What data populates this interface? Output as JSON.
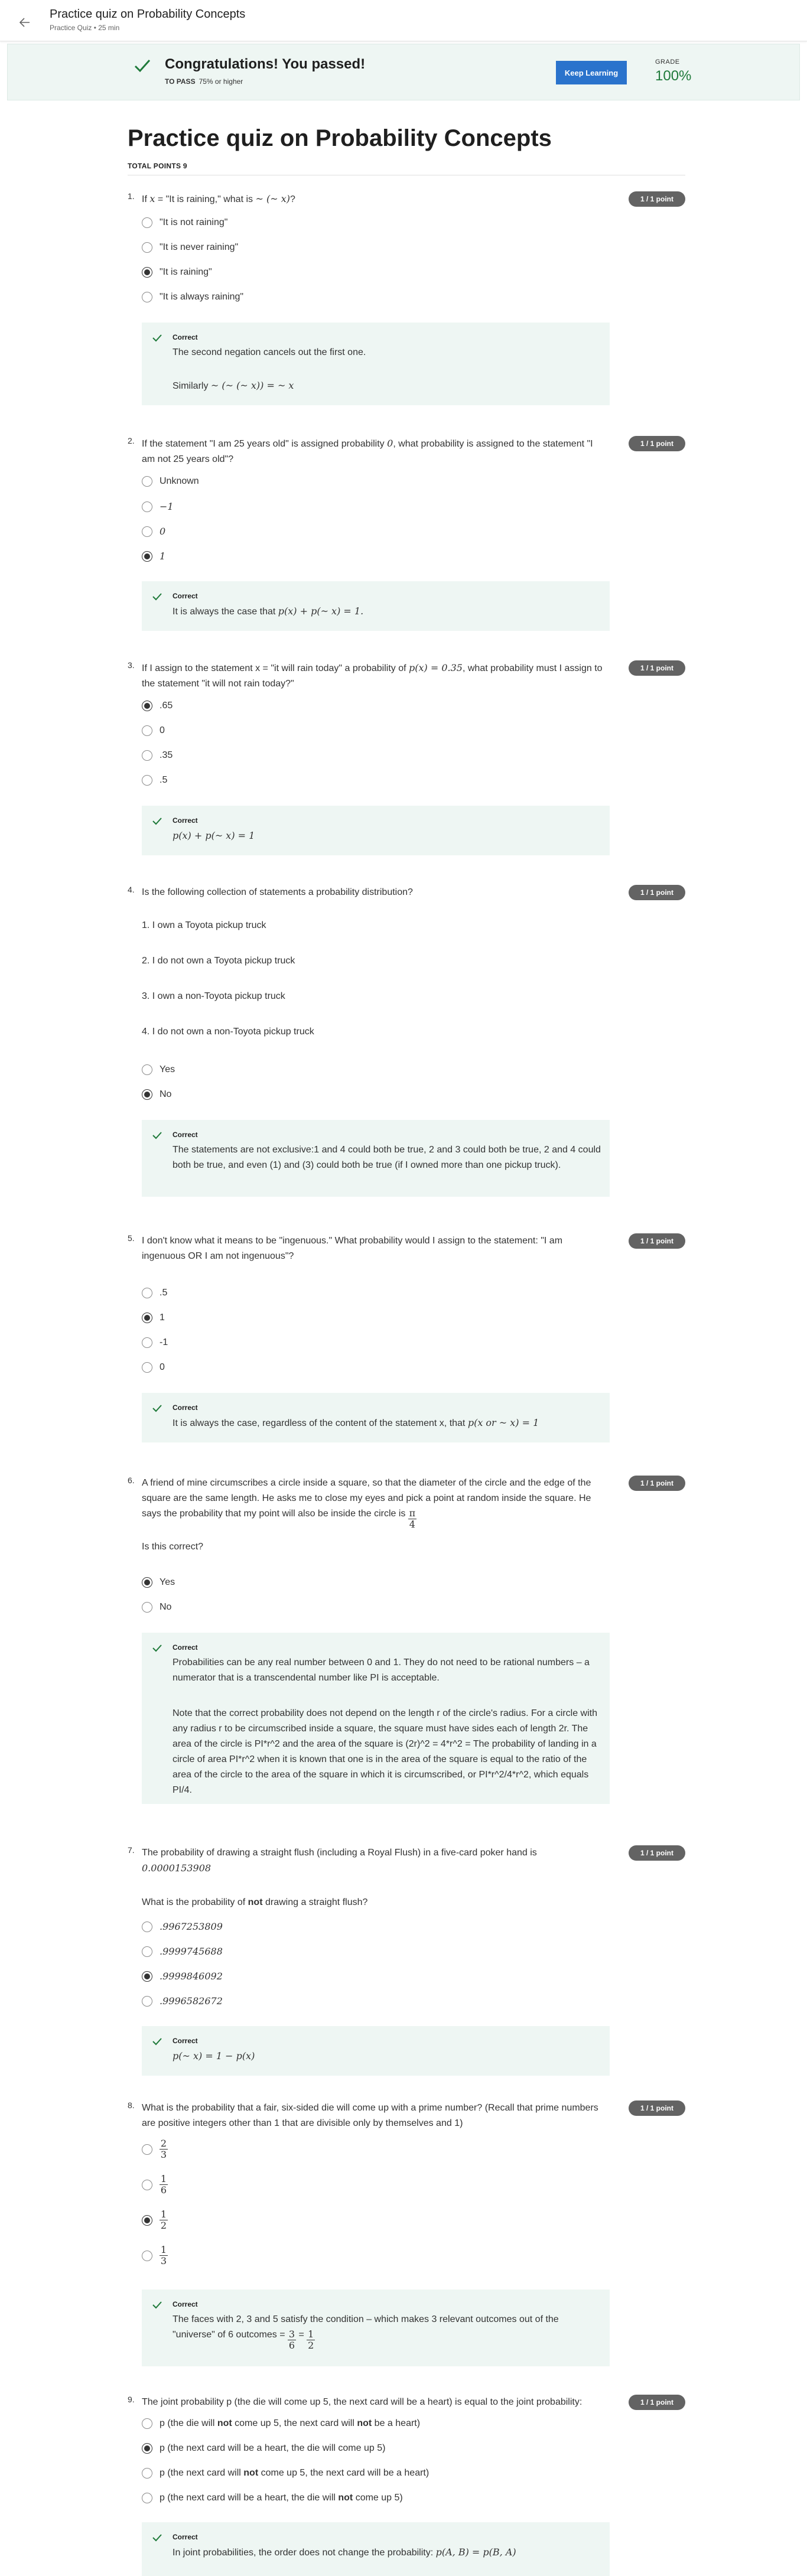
{
  "topbar": {
    "title": "Practice quiz on Probability Concepts",
    "subtitle": "Practice Quiz • 25 min"
  },
  "banner": {
    "title": "Congratulations! You passed!",
    "to_pass_label": "TO PASS",
    "to_pass_value": "75% or higher",
    "button": "Keep Learning",
    "grade_label": "GRADE",
    "grade_value": "100%"
  },
  "page": {
    "title": "Practice quiz on Probability Concepts",
    "total_points": "TOTAL POINTS 9"
  },
  "badge": "1 / 1 point",
  "correct": "Correct",
  "q1": {
    "num": "1.",
    "text_a": "If ",
    "text_math": "x",
    "text_b": " = \"It is raining,\" what is ",
    "text_math2": "~ (~ x)",
    "text_c": "?",
    "options": [
      "\"It is not raining\"",
      "\"It is never raining\"",
      "\"It is raining\"",
      "\"It is always raining\""
    ],
    "fb1": "The second negation cancels out the first one.",
    "fb2": "Similarly ",
    "fb2_math": "~ (~ (~ x)) = ~ x"
  },
  "q2": {
    "num": "2.",
    "text_a": "If the statement \"I am 25 years old\" is assigned probability ",
    "text_math": "0",
    "text_b": ", what probability is assigned to the statement \"I am not 25 years old\"?",
    "options": [
      "Unknown",
      "−1",
      "0",
      "1"
    ],
    "fb_a": "It is always the case that ",
    "fb_math": "p(x) + p(~ x) = 1."
  },
  "q3": {
    "num": "3.",
    "text_a": "If I assign to the statement x = \"it will rain today\" a probability of ",
    "text_math": "p(x) = 0.35",
    "text_b": ", what probability must I assign to the statement \"it will not rain today?\"",
    "options": [
      ".65",
      "0",
      ".35",
      ".5"
    ],
    "fb_math": "p(x) + p(~ x) = 1"
  },
  "q4": {
    "num": "4.",
    "text": "Is the following collection of statements a probability distribution?",
    "statements": [
      "1. I own a Toyota pickup truck",
      "2. I do not own a Toyota pickup truck",
      "3. I own a non-Toyota pickup truck",
      "4. I do not own a non-Toyota pickup truck"
    ],
    "options": [
      "Yes",
      "No"
    ],
    "fb": "The statements are not exclusive:1 and 4 could both be true, 2 and 3 could both be true, 2 and 4 could both be true, and even (1) and (3) could both be true (if I owned more than one pickup truck)."
  },
  "q5": {
    "num": "5.",
    "text": "I don't know what it means to be \"ingenuous.\" What probability would I assign to the statement: \"I am ingenuous OR I am not ingenuous\"?",
    "options": [
      ".5",
      "1",
      "-1",
      "0"
    ],
    "fb_a": "It is always the case, regardless of the content of the statement x, that ",
    "fb_math": "p(x or ~ x) = 1"
  },
  "q6": {
    "num": "6.",
    "text": "A friend of mine circumscribes a circle inside a square, so that the diameter of the circle and the edge of the square are the same length. He asks me to close my eyes and pick a point at random inside the square. He says the probability that my point will also be inside the circle is ",
    "frac_num": "π",
    "frac_den": "4",
    "question": "Is this correct?",
    "options": [
      "Yes",
      "No"
    ],
    "fb1": "Probabilities can be any real number between 0 and 1. They do not need to be rational numbers – a numerator that is a transcendental number like PI is acceptable.",
    "fb2": "Note that the correct probability does not depend on the length r of the circle's radius. For a circle with any radius r to be circumscribed inside a square, the square must have sides each of length 2r. The area of the circle is PI*r^2 and the area of the square is (2r)^2 = 4*r^2 = The probability of landing in a circle of area PI*r^2 when it is known that one is in the area of the square is equal to the ratio of the area of the circle to the area of the square in which it is circumscribed, or PI*r^2/4*r^2, which equals PI/4."
  },
  "q7": {
    "num": "7.",
    "text": "The probability of drawing a straight flush (including a Royal Flush) in a five-card poker hand is",
    "value": "0.0000153908",
    "question_a": "What is the probability of ",
    "question_bold": "not",
    "question_b": " drawing a straight flush?",
    "options": [
      ".9967253809",
      ".9999745688",
      ".9999846092",
      ".9996582672"
    ],
    "fb_math": "p(~ x) = 1 − p(x)"
  },
  "q8": {
    "num": "8.",
    "text": "What is the probability that a fair, six-sided die will come up with a prime number? (Recall that prime numbers are positive integers other than 1 that are divisible only by themselves and 1)",
    "options": [
      {
        "num": "2",
        "den": "3"
      },
      {
        "num": "1",
        "den": "6"
      },
      {
        "num": "1",
        "den": "2"
      },
      {
        "num": "1",
        "den": "3"
      }
    ],
    "fb_a": "The faces with 2, 3 and 5 satisfy the condition – which makes 3 relevant outcomes out of the \"universe\" of 6 outcomes = ",
    "fb_n1": "3",
    "fb_d1": "6",
    "fb_eq": "=",
    "fb_n2": "1",
    "fb_d2": "2"
  },
  "q9": {
    "num": "9.",
    "text": "The joint probability p (the die will come up 5, the next card will be a heart) is equal to the joint probability:",
    "options": [
      {
        "a": "p (the die will ",
        "b": "not",
        "c": " come up 5, the next card will ",
        "d": "not",
        "e": " be a heart)"
      },
      {
        "a": "p (the next card will be a heart, the die will come up 5)",
        "b": "",
        "c": "",
        "d": "",
        "e": ""
      },
      {
        "a": "p (the next card will ",
        "b": "not",
        "c": " come up 5, the next card will be a heart)",
        "d": "",
        "e": ""
      },
      {
        "a": "p (the next card will be a heart, the die will ",
        "b": "not",
        "c": " come up 5)",
        "d": "",
        "e": ""
      }
    ],
    "fb_a": "In joint probabilities, the order does not change the probability: ",
    "fb_math": "p(A, B) = p(B, A)"
  },
  "colors": {
    "accent": "#2a73cc",
    "success": "#1f7a3a",
    "feedback_bg": "#eef6f3",
    "badge_bg": "#636363"
  }
}
